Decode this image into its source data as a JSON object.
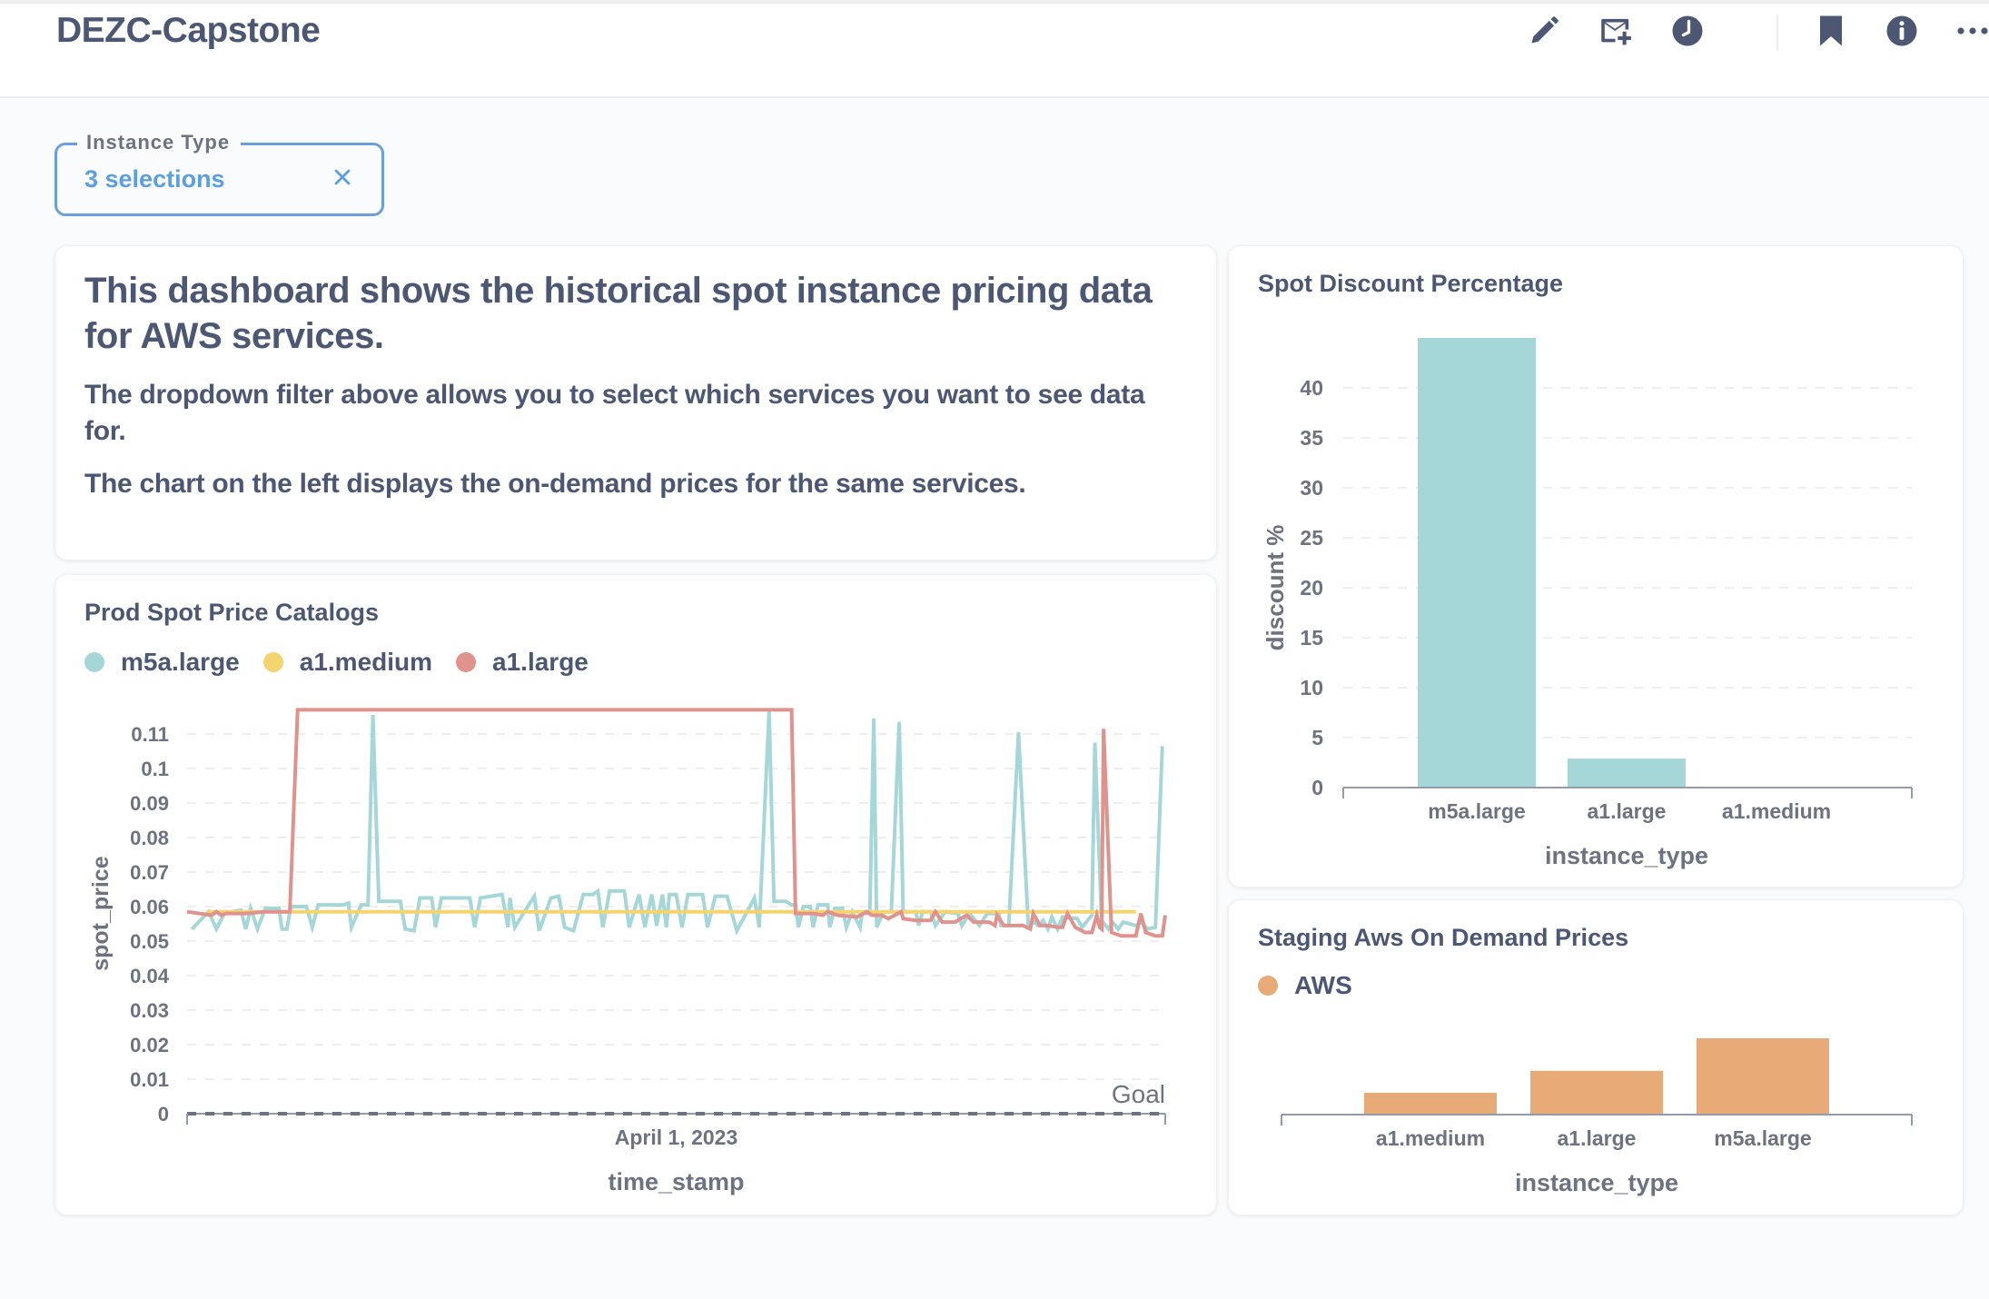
{
  "header": {
    "title": "DEZC-Capstone",
    "toolbar": [
      {
        "icon": "pencil-icon",
        "label": "Edit dashboard"
      },
      {
        "icon": "mail-plus-icon",
        "label": "Subscriptions"
      },
      {
        "icon": "clock-icon",
        "label": "Auto-refresh"
      },
      {
        "icon": "bookmark-icon",
        "label": "Bookmark"
      },
      {
        "icon": "info-icon",
        "label": "More info"
      },
      {
        "icon": "more-icon",
        "label": "More options"
      }
    ]
  },
  "filter": {
    "label": "Instance Type",
    "value": "3 selections",
    "clear_icon": "close-icon"
  },
  "text_card": {
    "heading": "This dashboard shows the historical spot instance pricing data for AWS services.",
    "paragraphs": [
      "The dropdown filter above allows you to select which services you want to see data for.",
      "The chart on the left displays the on-demand prices for the same services."
    ]
  },
  "colors": {
    "teal": "#a6d7d8",
    "yellow": "#f3d46e",
    "red": "#e0928d",
    "orange": "#e8ab77",
    "text": "#4c5773",
    "accent_blue": "#6a9fdc"
  },
  "chart_data": [
    {
      "id": "prod-spot-price-catalogs",
      "type": "line",
      "title": "Prod Spot Price Catalogs",
      "xlabel": "time_stamp",
      "ylabel": "spot_price",
      "x_tick_labels": [
        {
          "label": "April 1, 2023",
          "position": 0.5
        }
      ],
      "x_note": "x values are relative positions across the time range (0 = start, 1 = end); only one date tick is printed",
      "yticks": [
        0,
        0.01,
        0.02,
        0.03,
        0.04,
        0.05,
        0.06,
        0.07,
        0.08,
        0.09,
        0.1,
        0.11
      ],
      "ytick_labels": [
        "0",
        "0.01",
        "0.02",
        "0.03",
        "0.04",
        "0.05",
        "0.06",
        "0.07",
        "0.08",
        "0.09",
        "0.1",
        "0.11"
      ],
      "ylim": [
        0,
        0.117
      ],
      "grid": true,
      "legend": "top-left",
      "goal": {
        "label": "Goal",
        "value": 0
      },
      "series": [
        {
          "name": "m5a.large",
          "color": "#a6d7d8",
          "points": [
            [
              0.005,
              0.0535
            ],
            [
              0.022,
              0.0585
            ],
            [
              0.03,
              0.0535
            ],
            [
              0.038,
              0.058
            ],
            [
              0.055,
              0.059
            ],
            [
              0.06,
              0.0535
            ],
            [
              0.065,
              0.0595
            ],
            [
              0.072,
              0.0535
            ],
            [
              0.08,
              0.0595
            ],
            [
              0.094,
              0.0595
            ],
            [
              0.097,
              0.0535
            ],
            [
              0.102,
              0.0535
            ],
            [
              0.106,
              0.06
            ],
            [
              0.122,
              0.06
            ],
            [
              0.128,
              0.054
            ],
            [
              0.134,
              0.0605
            ],
            [
              0.16,
              0.0605
            ],
            [
              0.165,
              0.061
            ],
            [
              0.168,
              0.054
            ],
            [
              0.178,
              0.0605
            ],
            [
              0.185,
              0.0605
            ],
            [
              0.19,
              0.1155
            ],
            [
              0.196,
              0.0615
            ],
            [
              0.218,
              0.0615
            ],
            [
              0.223,
              0.0535
            ],
            [
              0.232,
              0.053
            ],
            [
              0.238,
              0.0625
            ],
            [
              0.25,
              0.0625
            ],
            [
              0.254,
              0.054
            ],
            [
              0.26,
              0.0625
            ],
            [
              0.289,
              0.0625
            ],
            [
              0.294,
              0.054
            ],
            [
              0.3,
              0.0625
            ],
            [
              0.322,
              0.0635
            ],
            [
              0.328,
              0.054
            ],
            [
              0.33,
              0.0625
            ],
            [
              0.335,
              0.054
            ],
            [
              0.355,
              0.063
            ],
            [
              0.36,
              0.053
            ],
            [
              0.372,
              0.0625
            ],
            [
              0.38,
              0.063
            ],
            [
              0.386,
              0.054
            ],
            [
              0.395,
              0.053
            ],
            [
              0.405,
              0.0635
            ],
            [
              0.415,
              0.0635
            ],
            [
              0.42,
              0.0645
            ],
            [
              0.425,
              0.054
            ],
            [
              0.432,
              0.0645
            ],
            [
              0.447,
              0.0645
            ],
            [
              0.452,
              0.054
            ],
            [
              0.462,
              0.0635
            ],
            [
              0.468,
              0.054
            ],
            [
              0.475,
              0.0635
            ],
            [
              0.48,
              0.0545
            ],
            [
              0.486,
              0.0635
            ],
            [
              0.49,
              0.054
            ],
            [
              0.493,
              0.0635
            ],
            [
              0.5,
              0.0635
            ],
            [
              0.506,
              0.054
            ],
            [
              0.512,
              0.0635
            ],
            [
              0.527,
              0.0635
            ],
            [
              0.532,
              0.054
            ],
            [
              0.54,
              0.063
            ],
            [
              0.552,
              0.063
            ],
            [
              0.562,
              0.053
            ],
            [
              0.58,
              0.0625
            ],
            [
              0.585,
              0.054
            ],
            [
              0.595,
              0.1165
            ],
            [
              0.6,
              0.0615
            ],
            [
              0.612,
              0.0615
            ],
            [
              0.618,
              0.0605
            ],
            [
              0.622,
              0.0605
            ],
            [
              0.625,
              0.054
            ],
            [
              0.63,
              0.06
            ],
            [
              0.637,
              0.06
            ],
            [
              0.64,
              0.054
            ],
            [
              0.645,
              0.0605
            ],
            [
              0.655,
              0.0605
            ],
            [
              0.657,
              0.054
            ],
            [
              0.662,
              0.0595
            ],
            [
              0.67,
              0.0595
            ],
            [
              0.674,
              0.054
            ],
            [
              0.68,
              0.0585
            ],
            [
              0.688,
              0.054
            ],
            [
              0.69,
              0.058
            ],
            [
              0.698,
              0.058
            ],
            [
              0.702,
              0.1145
            ],
            [
              0.705,
              0.054
            ],
            [
              0.712,
              0.0585
            ],
            [
              0.72,
              0.0585
            ],
            [
              0.728,
              0.1135
            ],
            [
              0.732,
              0.0585
            ],
            [
              0.745,
              0.0585
            ],
            [
              0.748,
              0.0545
            ],
            [
              0.752,
              0.0585
            ],
            [
              0.76,
              0.0585
            ],
            [
              0.765,
              0.0545
            ],
            [
              0.775,
              0.0585
            ],
            [
              0.788,
              0.058
            ],
            [
              0.792,
              0.0545
            ],
            [
              0.8,
              0.058
            ],
            [
              0.81,
              0.0545
            ],
            [
              0.818,
              0.058
            ],
            [
              0.83,
              0.058
            ],
            [
              0.832,
              0.0545
            ],
            [
              0.84,
              0.0545
            ],
            [
              0.85,
              0.1105
            ],
            [
              0.86,
              0.0545
            ],
            [
              0.866,
              0.0555
            ],
            [
              0.87,
              0.0545
            ],
            [
              0.875,
              0.056
            ],
            [
              0.88,
              0.0535
            ],
            [
              0.884,
              0.057
            ],
            [
              0.89,
              0.0535
            ],
            [
              0.895,
              0.057
            ],
            [
              0.91,
              0.0565
            ],
            [
              0.915,
              0.054
            ],
            [
              0.925,
              0.0575
            ],
            [
              0.928,
              0.1075
            ],
            [
              0.935,
              0.056
            ],
            [
              0.942,
              0.0535
            ],
            [
              0.946,
              0.0555
            ],
            [
              0.952,
              0.0535
            ],
            [
              0.957,
              0.0555
            ],
            [
              0.97,
              0.0545
            ],
            [
              0.975,
              0.0555
            ],
            [
              0.982,
              0.0535
            ],
            [
              0.99,
              0.054
            ],
            [
              0.997,
              0.1065
            ]
          ]
        },
        {
          "name": "a1.medium",
          "color": "#f3d46e",
          "points": [
            [
              0.02,
              0.0585
            ],
            [
              0.97,
              0.0585
            ]
          ]
        },
        {
          "name": "a1.large",
          "color": "#e0928d",
          "points": [
            [
              0.0,
              0.0585
            ],
            [
              0.025,
              0.0575
            ],
            [
              0.03,
              0.0585
            ],
            [
              0.035,
              0.0575
            ],
            [
              0.04,
              0.058
            ],
            [
              0.06,
              0.058
            ],
            [
              0.08,
              0.0585
            ],
            [
              0.105,
              0.0585
            ],
            [
              0.113,
              0.117
            ],
            [
              0.618,
              0.117
            ],
            [
              0.622,
              0.058
            ],
            [
              0.64,
              0.058
            ],
            [
              0.65,
              0.0575
            ],
            [
              0.655,
              0.0585
            ],
            [
              0.665,
              0.0575
            ],
            [
              0.685,
              0.057
            ],
            [
              0.695,
              0.0585
            ],
            [
              0.7,
              0.0575
            ],
            [
              0.71,
              0.0575
            ],
            [
              0.717,
              0.0565
            ],
            [
              0.73,
              0.0585
            ],
            [
              0.732,
              0.0565
            ],
            [
              0.745,
              0.056
            ],
            [
              0.76,
              0.056
            ],
            [
              0.765,
              0.0585
            ],
            [
              0.772,
              0.0555
            ],
            [
              0.785,
              0.0555
            ],
            [
              0.797,
              0.0575
            ],
            [
              0.804,
              0.0555
            ],
            [
              0.82,
              0.0555
            ],
            [
              0.826,
              0.0545
            ],
            [
              0.828,
              0.0575
            ],
            [
              0.835,
              0.0545
            ],
            [
              0.855,
              0.0545
            ],
            [
              0.862,
              0.0535
            ],
            [
              0.865,
              0.058
            ],
            [
              0.872,
              0.0545
            ],
            [
              0.88,
              0.0545
            ],
            [
              0.89,
              0.054
            ],
            [
              0.895,
              0.054
            ],
            [
              0.9,
              0.058
            ],
            [
              0.908,
              0.054
            ],
            [
              0.918,
              0.0525
            ],
            [
              0.925,
              0.0525
            ],
            [
              0.93,
              0.0575
            ],
            [
              0.933,
              0.054
            ],
            [
              0.935,
              0.0535
            ],
            [
              0.937,
              0.1115
            ],
            [
              0.945,
              0.0525
            ],
            [
              0.955,
              0.0515
            ],
            [
              0.97,
              0.0515
            ],
            [
              0.975,
              0.058
            ],
            [
              0.98,
              0.0525
            ],
            [
              0.99,
              0.0515
            ],
            [
              0.997,
              0.0515
            ],
            [
              1.0,
              0.0575
            ]
          ]
        }
      ]
    },
    {
      "id": "spot-discount-percentage",
      "type": "bar",
      "title": "Spot Discount Percentage",
      "xlabel": "instance_type",
      "ylabel": "discount %",
      "categories": [
        "m5a.large",
        "a1.large",
        "a1.medium"
      ],
      "values": [
        45.0,
        2.9,
        0
      ],
      "yticks": [
        0,
        5,
        10,
        15,
        20,
        25,
        30,
        35,
        40
      ],
      "ylim": [
        0,
        45
      ],
      "grid": true,
      "color": "#a6d7d8"
    },
    {
      "id": "staging-aws-on-demand-prices",
      "type": "bar",
      "title": "Staging Aws On Demand Prices",
      "xlabel": "instance_type",
      "ylabel": "",
      "legend": "top-left",
      "series": [
        {
          "name": "AWS",
          "color": "#e8ab77",
          "values": [
            0.0255,
            0.051,
            0.089
          ]
        }
      ],
      "categories": [
        "a1.medium",
        "a1.large",
        "m5a.large"
      ],
      "yaxis_visible": false,
      "values_note": "no y-axis printed; values estimated from relative bar heights"
    }
  ]
}
